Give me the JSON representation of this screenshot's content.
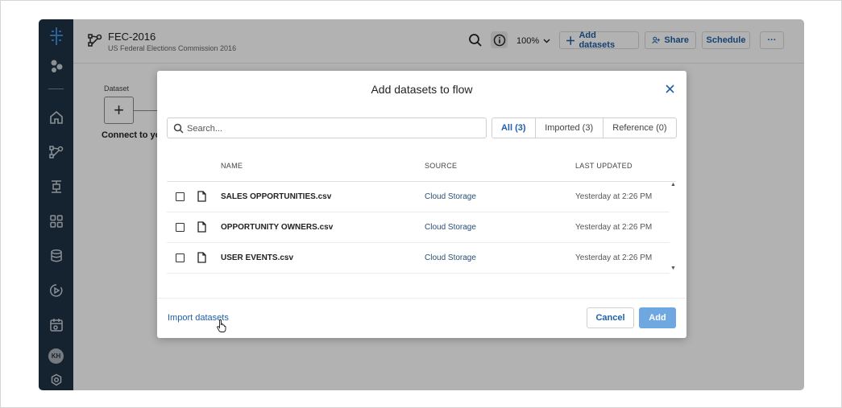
{
  "flow": {
    "title": "FEC-2016",
    "subtitle": "US Federal Elections Commission 2016"
  },
  "toolbar": {
    "zoom": "100%",
    "add_datasets": "Add datasets",
    "share": "Share",
    "schedule": "Schedule",
    "more": "···"
  },
  "sidebar": {
    "avatar_initials": "KH",
    "icons": [
      "app-logo-icon",
      "datasets-bubbles-icon",
      "home-icon",
      "flow-icon",
      "plans-icon",
      "apps-grid-icon",
      "database-icon",
      "jobs-icon",
      "schedule-calendar-icon",
      "settings-icon"
    ]
  },
  "canvas": {
    "dataset_label": "Dataset",
    "add_symbol": "+",
    "connect_text": "Connect to yo"
  },
  "modal": {
    "title": "Add datasets to flow",
    "search_placeholder": "Search...",
    "filters": [
      {
        "label": "All (3)",
        "active": true
      },
      {
        "label": "Imported (3)",
        "active": false
      },
      {
        "label": "Reference (0)",
        "active": false
      }
    ],
    "columns": {
      "name": "NAME",
      "source": "SOURCE",
      "updated": "LAST UPDATED"
    },
    "rows": [
      {
        "name": "SALES OPPORTUNITIES.csv",
        "source": "Cloud Storage",
        "updated": "Yesterday at 2:26 PM"
      },
      {
        "name": "OPPORTUNITY OWNERS.csv",
        "source": "Cloud Storage",
        "updated": "Yesterday at 2:26 PM"
      },
      {
        "name": "USER EVENTS.csv",
        "source": "Cloud Storage",
        "updated": "Yesterday at 2:26 PM"
      }
    ],
    "import_link": "Import datasets",
    "cancel": "Cancel",
    "add": "Add"
  },
  "colors": {
    "sidebar": "#1f3144",
    "accent": "#1f5fa8",
    "add_button": "#6fa8e0"
  }
}
